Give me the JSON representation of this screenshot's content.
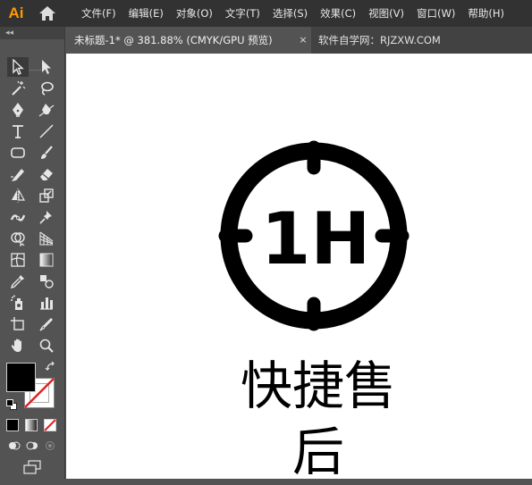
{
  "app": {
    "logo": "Ai"
  },
  "menu": {
    "items": [
      "文件(F)",
      "编辑(E)",
      "对象(O)",
      "文字(T)",
      "选择(S)",
      "效果(C)",
      "视图(V)",
      "窗口(W)",
      "帮助(H)"
    ]
  },
  "tabs": {
    "active": "未标题-1* @ 381.88% (CMYK/GPU 预览)",
    "close": "×",
    "second": "软件自学网：RJZXW.COM"
  },
  "toolbox": {
    "collapse": "◂◂"
  },
  "artwork": {
    "icon_text": "1H",
    "caption": "快捷售后"
  },
  "colors": {
    "menubar": "#323232",
    "panel": "#535353",
    "tabbar": "#424242",
    "logo": "#ff9a00",
    "canvas": "#ffffff"
  }
}
